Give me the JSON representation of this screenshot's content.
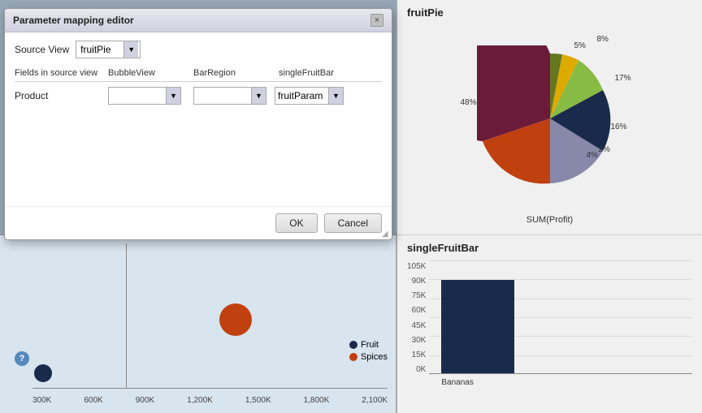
{
  "modal": {
    "title": "Parameter mapping editor",
    "close_label": "×",
    "source_view_label": "Source View",
    "source_view_value": "fruitPie",
    "fields_header_label": "Fields in source view",
    "col_bubble": "BubbleView",
    "col_bar": "BarRegion",
    "col_single": "singleFruitBar",
    "row_field": "Product",
    "row_bubble_value": "",
    "row_bar_value": "",
    "row_single_value": "fruitParam",
    "ok_label": "OK",
    "cancel_label": "Cancel",
    "help_icon": "?"
  },
  "fruitpie": {
    "title": "fruitPie",
    "sum_label": "SUM(Profit)",
    "labels": [
      "5%",
      "8%",
      "17%",
      "16%",
      "2%",
      "4%",
      "48%"
    ]
  },
  "singlefruitbar": {
    "title": "singleFruitBar",
    "y_labels": [
      "105K",
      "90K",
      "75K",
      "60K",
      "45K",
      "30K",
      "15K",
      "0K"
    ],
    "bar_label": "Bananas",
    "bar_height_pct": 82
  },
  "scatter": {
    "legend": [
      {
        "label": "Fruit",
        "color": "#1a2a4a"
      },
      {
        "label": "Spices",
        "color": "#c04010"
      }
    ],
    "x_ticks": [
      "300K",
      "600K",
      "900K",
      "1,200K",
      "1,500K",
      "1,800K",
      "2,100K"
    ]
  },
  "toolbar": {
    "icons": [
      "⊞",
      "⊟",
      "⊠"
    ]
  }
}
